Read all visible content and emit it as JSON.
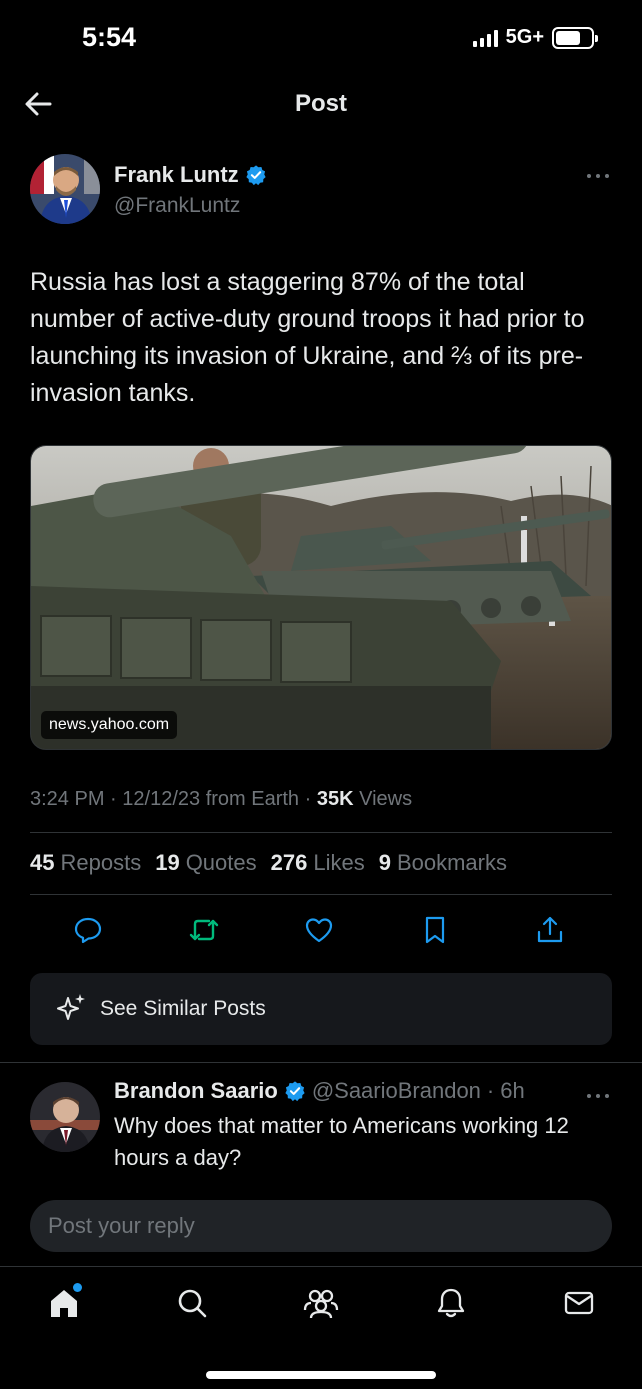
{
  "status": {
    "time": "5:54",
    "network": "5G+"
  },
  "header": {
    "title": "Post"
  },
  "post": {
    "author_name": "Frank Luntz",
    "author_handle": "@FrankLuntz",
    "text": "Russia has lost a staggering 87% of the total number of active-duty ground troops it had prior to launching its invasion of Ukraine, and ⅔ of its pre-invasion tanks.",
    "media_source": "news.yahoo.com",
    "meta": {
      "time": "3:24 PM",
      "date": "12/12/23",
      "source": "from Earth",
      "views_count": "35K",
      "views_label": "Views"
    },
    "stats": [
      {
        "count": "45",
        "label": "Reposts"
      },
      {
        "count": "19",
        "label": "Quotes"
      },
      {
        "count": "276",
        "label": "Likes"
      },
      {
        "count": "9",
        "label": "Bookmarks"
      }
    ]
  },
  "similar": {
    "label": "See Similar Posts"
  },
  "reply": {
    "author_name": "Brandon Saario",
    "author_handle": "@SaarioBrandon",
    "time": "6h",
    "text": "Why does that matter to Americans working 12 hours a day?"
  },
  "reply_bar": {
    "placeholder": "Post your reply"
  },
  "colors": {
    "accent": "#1d9bf0",
    "repost": "#00ba7c",
    "muted": "#71767b",
    "background": "#000000"
  },
  "icons": [
    "back-arrow-icon",
    "verified-badge-icon",
    "more-icon",
    "reply-icon",
    "repost-icon",
    "like-icon",
    "bookmark-icon",
    "share-icon",
    "sparkle-icon",
    "home-icon",
    "search-icon",
    "communities-icon",
    "notifications-icon",
    "messages-icon"
  ]
}
